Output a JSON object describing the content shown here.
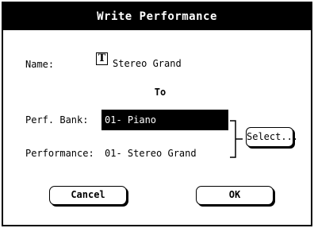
{
  "dialog": {
    "title": "Write Performance",
    "name_label": "Name:",
    "name_icon": "T",
    "name_value": "Stereo Grand",
    "to_label": "To",
    "bank_label": "Perf. Bank:",
    "bank_value": "01- Piano",
    "performance_label": "Performance:",
    "performance_value": "01- Stereo Grand",
    "select_label": "Select...",
    "cancel_label": "Cancel",
    "ok_label": "OK"
  },
  "icons": {
    "text-edit": "text-edit-icon",
    "bracket": "bracket-icon"
  },
  "colors": {
    "background": "#ffffff",
    "title_bar": "#000000",
    "title_text": "#ffffff",
    "selected_field": "#000000"
  }
}
